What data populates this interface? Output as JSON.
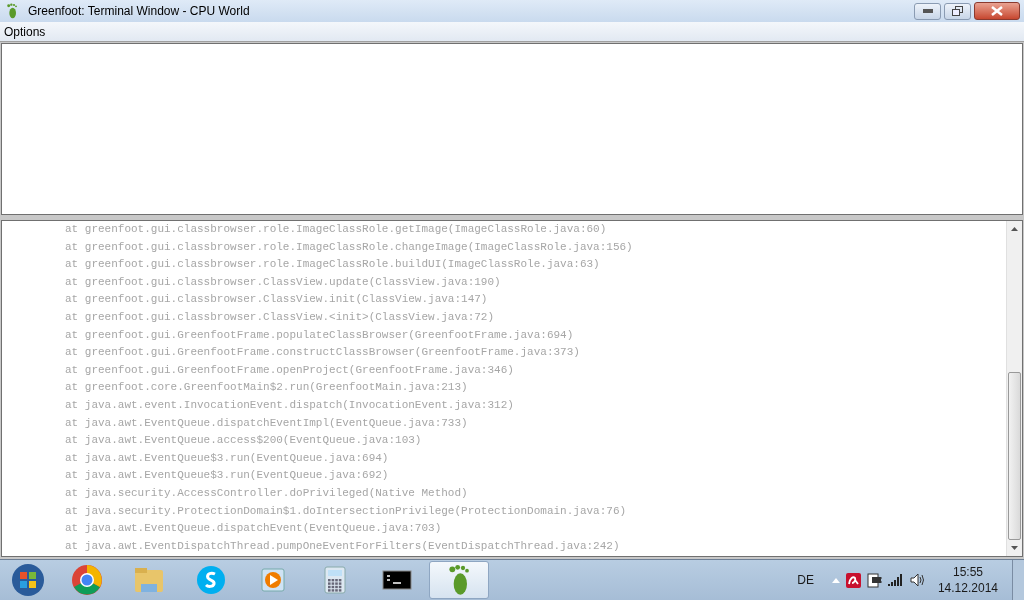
{
  "window": {
    "title": "Greenfoot: Terminal Window - CPU World"
  },
  "menu": [
    "Options"
  ],
  "log_lines": [
    "at greenfoot.gui.classbrowser.role.ImageClassRole.getImage(ImageClassRole.java:60)",
    "at greenfoot.gui.classbrowser.role.ImageClassRole.changeImage(ImageClassRole.java:156)",
    "at greenfoot.gui.classbrowser.role.ImageClassRole.buildUI(ImageClassRole.java:63)",
    "at greenfoot.gui.classbrowser.ClassView.update(ClassView.java:190)",
    "at greenfoot.gui.classbrowser.ClassView.init(ClassView.java:147)",
    "at greenfoot.gui.classbrowser.ClassView.<init>(ClassView.java:72)",
    "at greenfoot.gui.GreenfootFrame.populateClassBrowser(GreenfootFrame.java:694)",
    "at greenfoot.gui.GreenfootFrame.constructClassBrowser(GreenfootFrame.java:373)",
    "at greenfoot.gui.GreenfootFrame.openProject(GreenfootFrame.java:346)",
    "at greenfoot.core.GreenfootMain$2.run(GreenfootMain.java:213)",
    "at java.awt.event.InvocationEvent.dispatch(InvocationEvent.java:312)",
    "at java.awt.EventQueue.dispatchEventImpl(EventQueue.java:733)",
    "at java.awt.EventQueue.access$200(EventQueue.java:103)",
    "at java.awt.EventQueue$3.run(EventQueue.java:694)",
    "at java.awt.EventQueue$3.run(EventQueue.java:692)",
    "at java.security.AccessController.doPrivileged(Native Method)",
    "at java.security.ProtectionDomain$1.doIntersectionPrivilege(ProtectionDomain.java:76)",
    "at java.awt.EventQueue.dispatchEvent(EventQueue.java:703)",
    "at java.awt.EventDispatchThread.pumpOneEventForFilters(EventDispatchThread.java:242)"
  ],
  "taskbar": {
    "apps": [
      {
        "kind": "browser",
        "selected": false
      },
      {
        "kind": "folder",
        "selected": false
      },
      {
        "kind": "chat",
        "selected": false
      },
      {
        "kind": "media",
        "selected": false
      },
      {
        "kind": "calculator",
        "selected": false
      },
      {
        "kind": "console",
        "selected": false
      },
      {
        "kind": "greenfoot",
        "selected": true
      }
    ],
    "language": "DE",
    "time": "15:55",
    "date": "14.12.2014"
  }
}
